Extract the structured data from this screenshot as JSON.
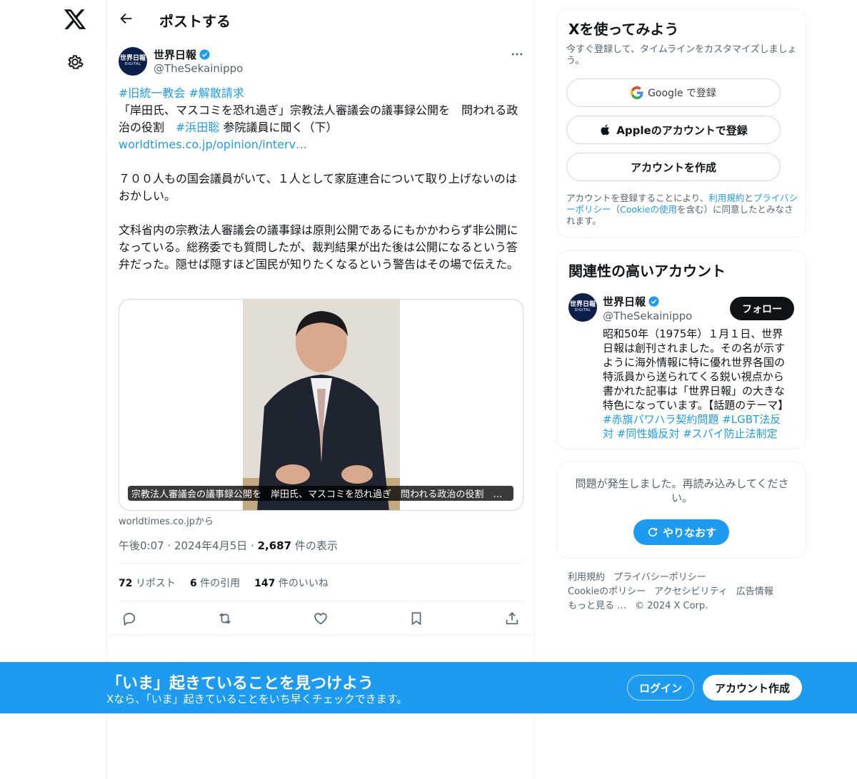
{
  "header": {
    "title": "ポストする"
  },
  "post": {
    "author_name": "世界日報",
    "author_handle": "@TheSekainippo",
    "avatar_text_top": "世界日報",
    "avatar_text_bottom": "DIGITAL",
    "hashtag_1": "#旧統一教会",
    "hashtag_2": "#解散請求",
    "text_a": "「岸田氏、マスコミを恐れ過ぎ」宗教法人審議会の議事録公開を　問われる政治の役割　",
    "hashtag_3": "#浜田聡",
    "text_b": " 参院議員に聞く（下）",
    "link": "worldtimes.co.jp/opinion/interv…",
    "paragraph_1": "７００人もの国会議員がいて、１人として家庭連合について取り上げないのはおかしい。",
    "paragraph_2": "文科省内の宗教法人審議会の議事録は原則公開であるにもかかわらず非公開になっている。総務委でも質問したが、裁判結果が出た後は公開になるという答弁だった。隠せば隠すほど国民が知りたくなるという警告はその場で伝えた。",
    "card_caption": "宗教法人審議会の議事録公開を　岸田氏、マスコミを恐れ過ぎ　問われる政治の役割　浜…",
    "card_source": "worldtimes.co.jpから",
    "time": "午後0:07",
    "date": "2024年4月5日",
    "views_count": "2,687",
    "views_label": "件の表示",
    "reposts_count": "72",
    "reposts_label": "リポスト",
    "quotes_count": "6",
    "quotes_label": "件の引用",
    "likes_count": "147",
    "likes_label": "件のいいね"
  },
  "signup_box": {
    "title": "Xを使ってみよう",
    "subtitle": "今すぐ登録して、タイムラインをカスタマイズしましょう。",
    "google_label": "Google で登録",
    "apple_label": "Appleのアカウントで登録",
    "create_label": "アカウントを作成",
    "terms_1": "アカウントを登録することにより、",
    "terms_link_1": "利用規約",
    "terms_2": "と",
    "terms_link_2": "プライバシーポリシー",
    "terms_3": "（",
    "terms_link_3": "Cookieの使用",
    "terms_4": "を含む）に同意したとみなされます。"
  },
  "relevant": {
    "title": "関連性の高いアカウント",
    "name": "世界日報",
    "handle": "@TheSekainippo",
    "follow_label": "フォロー",
    "bio": "昭和50年（1975年）１月１日、世界日報は創刊されました。その名が示すように海外情報に特に優れ世界各国の特派員から送られてくる鋭い視点から書かれた記事は「世界日報」の大きな特色になっています。【話題のテーマ】",
    "bio_tags": "#赤旗パワハラ契約問題 #LGBT法反対 #同性婚反対 #スパイ防止法制定"
  },
  "error_box": {
    "message": "問題が発生しました。再読み込みしてください。",
    "retry_label": "やりなおす"
  },
  "footer": {
    "terms": "利用規約",
    "privacy": "プライバシーポリシー",
    "cookie": "Cookieのポリシー",
    "accessibility": "アクセシビリティ",
    "ads": "広告情報",
    "more": "もっと見る …",
    "copyright": "© 2024 X Corp."
  },
  "banner": {
    "title": "「いま」起きていることを見つけよう",
    "subtitle": "Xなら、「いま」起きていることをいち早くチェックできます。",
    "login_label": "ログイン",
    "signup_label": "アカウント作成"
  },
  "colors": {
    "accent": "#1d9bf0",
    "text": "#0f1419",
    "muted": "#536471"
  }
}
